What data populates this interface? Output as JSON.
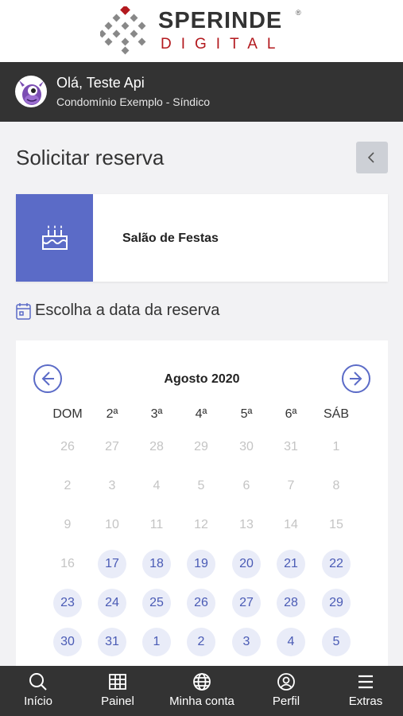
{
  "brand": {
    "name": "SPERINDE",
    "registered": "®",
    "sub": "DIGITAL"
  },
  "user": {
    "greeting": "Olá, Teste Api",
    "condo": "Condomínio Exemplo - Síndico"
  },
  "page": {
    "title": "Solicitar reserva"
  },
  "venue": {
    "name": "Salão de Festas",
    "icon": "cake-icon"
  },
  "date_section": {
    "label": "Escolha a data da reserva",
    "icon": "calendar-icon"
  },
  "calendar": {
    "month": "Agosto 2020",
    "weekdays": [
      "DOM",
      "2ª",
      "3ª",
      "4ª",
      "5ª",
      "6ª",
      "SÁB"
    ],
    "weeks": [
      [
        {
          "d": "26",
          "s": "off"
        },
        {
          "d": "27",
          "s": "off"
        },
        {
          "d": "28",
          "s": "off"
        },
        {
          "d": "29",
          "s": "off"
        },
        {
          "d": "30",
          "s": "off"
        },
        {
          "d": "31",
          "s": "off"
        },
        {
          "d": "1",
          "s": "off"
        }
      ],
      [
        {
          "d": "2",
          "s": "off"
        },
        {
          "d": "3",
          "s": "off"
        },
        {
          "d": "4",
          "s": "off"
        },
        {
          "d": "5",
          "s": "off"
        },
        {
          "d": "6",
          "s": "off"
        },
        {
          "d": "7",
          "s": "off"
        },
        {
          "d": "8",
          "s": "off"
        }
      ],
      [
        {
          "d": "9",
          "s": "off"
        },
        {
          "d": "10",
          "s": "off"
        },
        {
          "d": "11",
          "s": "off"
        },
        {
          "d": "12",
          "s": "off"
        },
        {
          "d": "13",
          "s": "off"
        },
        {
          "d": "14",
          "s": "off"
        },
        {
          "d": "15",
          "s": "off"
        }
      ],
      [
        {
          "d": "16",
          "s": "off"
        },
        {
          "d": "17",
          "s": "on"
        },
        {
          "d": "18",
          "s": "on"
        },
        {
          "d": "19",
          "s": "on"
        },
        {
          "d": "20",
          "s": "on"
        },
        {
          "d": "21",
          "s": "on"
        },
        {
          "d": "22",
          "s": "on"
        }
      ],
      [
        {
          "d": "23",
          "s": "on"
        },
        {
          "d": "24",
          "s": "on"
        },
        {
          "d": "25",
          "s": "on"
        },
        {
          "d": "26",
          "s": "on"
        },
        {
          "d": "27",
          "s": "on"
        },
        {
          "d": "28",
          "s": "on"
        },
        {
          "d": "29",
          "s": "on"
        }
      ],
      [
        {
          "d": "30",
          "s": "on"
        },
        {
          "d": "31",
          "s": "on"
        },
        {
          "d": "1",
          "s": "on"
        },
        {
          "d": "2",
          "s": "on"
        },
        {
          "d": "3",
          "s": "on"
        },
        {
          "d": "4",
          "s": "on"
        },
        {
          "d": "5",
          "s": "on"
        }
      ]
    ]
  },
  "tabs": [
    {
      "label": "Início",
      "icon": "search-icon"
    },
    {
      "label": "Painel",
      "icon": "grid-icon"
    },
    {
      "label": "Minha conta",
      "icon": "globe-icon"
    },
    {
      "label": "Perfil",
      "icon": "user-icon"
    },
    {
      "label": "Extras",
      "icon": "menu-icon"
    }
  ],
  "colors": {
    "accent": "#5b6bc7",
    "brand_red": "#b3191e",
    "dark_bar": "#333333",
    "available_bg": "#e9ecf8"
  }
}
